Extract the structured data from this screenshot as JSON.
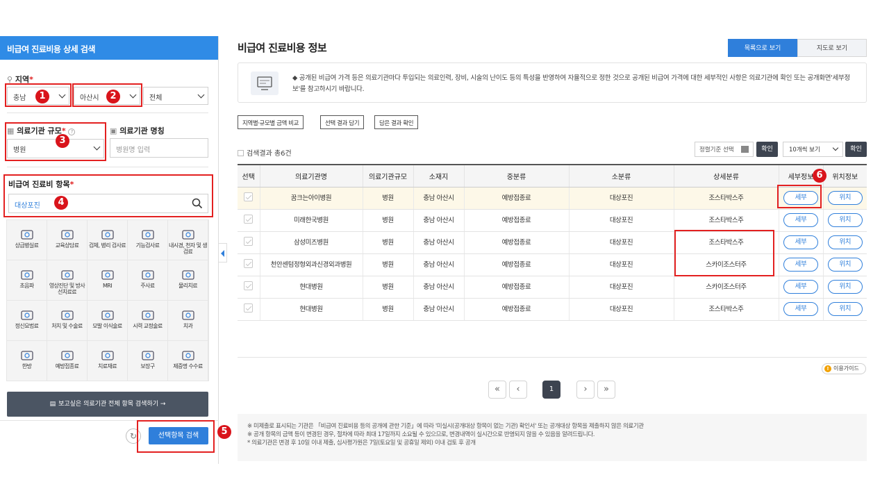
{
  "left": {
    "title": "비급여 진료비용 상세 검색",
    "region_label": "지역",
    "region": {
      "sido": "충남",
      "sigungu": "아산시",
      "dong": "전체"
    },
    "scale_label": "의료기관 규모",
    "scale_value": "병원",
    "name_label": "의료기관 명칭",
    "name_placeholder": "병원명 입력",
    "item_label": "비급여 진료비 항목",
    "item_value": "대상포진",
    "categories": [
      "상급병실료",
      "교육상담료",
      "검체, 병리 검사료",
      "기능검사료",
      "내시경, 천자 및 생검료",
      "초음파",
      "영상진단 및 방사선치료료",
      "MRI",
      "주사료",
      "물리치료",
      "정신요법료",
      "처치 및 수술료",
      "모발 이식술료",
      "시력 교정술료",
      "치과",
      "한방",
      "예방접종료",
      "치료재료",
      "보장구",
      "제증명 수수료"
    ],
    "all_button": "보고싶은 의료기관 전체 항목 검색하기 →",
    "search_button": "선택항목 검색",
    "reset_symbol": "↻"
  },
  "annotations": {
    "b1": "1",
    "b2": "2",
    "b3": "3",
    "b4": "4",
    "b5": "5",
    "b6": "6"
  },
  "main": {
    "title": "비급여 진료비용 정보",
    "view_list": "목록으로 보기",
    "view_map": "지도로 보기",
    "notice": "◆ 공개된 비급여 가격 등은 의료기관마다 투입되는 의료인력, 장비, 시술의 난이도 등의 특성을 반영하여 자율적으로 정한 것으로 공개된 비급여 가격에 대한 세부적인 사항은 의료기관에 확인 또는 공개화면'세부정보'를 참고하시기 바랍니다.",
    "btn_compare": "지역별·규모별 금액 비교",
    "btn_save": "선택 결과 담기",
    "btn_check": "담은 결과 확인",
    "count": "검색결과 총6건",
    "sort_placeholder": "정렬기준 선택",
    "sort_confirm": "확인",
    "per_page": "10개씩 보기",
    "per_confirm": "확인",
    "columns": [
      "선택",
      "의료기관명",
      "의료기관규모",
      "소재지",
      "중분류",
      "소분류",
      "상세분류",
      "세부정보",
      "위치정보"
    ],
    "rows": [
      {
        "name": "꿈크는아이병원",
        "scale": "병원",
        "loc": "충남 아산시",
        "mid": "예방접종료",
        "sub": "대상포진",
        "detail": "조스타박스주",
        "info": "세부",
        "pos": "위치"
      },
      {
        "name": "미래한국병원",
        "scale": "병원",
        "loc": "충남 아산시",
        "mid": "예방접종료",
        "sub": "대상포진",
        "detail": "조스타박스주",
        "info": "세부",
        "pos": "위치"
      },
      {
        "name": "삼성미즈병원",
        "scale": "병원",
        "loc": "충남 아산시",
        "mid": "예방접종료",
        "sub": "대상포진",
        "detail": "조스타박스주",
        "info": "세부",
        "pos": "위치"
      },
      {
        "name": "천안센텀정형외과신경외과병원",
        "scale": "병원",
        "loc": "충남 아산시",
        "mid": "예방접종료",
        "sub": "대상포진",
        "detail": "스카이조스터주",
        "info": "세부",
        "pos": "위치"
      },
      {
        "name": "현대병원",
        "scale": "병원",
        "loc": "충남 아산시",
        "mid": "예방접종료",
        "sub": "대상포진",
        "detail": "스카이조스터주",
        "info": "세부",
        "pos": "위치"
      },
      {
        "name": "현대병원",
        "scale": "병원",
        "loc": "충남 아산시",
        "mid": "예방접종료",
        "sub": "대상포진",
        "detail": "조스타박스주",
        "info": "세부",
        "pos": "위치"
      }
    ],
    "guide": "이용가이드",
    "pagination": {
      "first": "«",
      "prev": "‹",
      "current": "1",
      "next": "›",
      "last": "»"
    },
    "footnotes": [
      "※ 미제출로 표시되는 기관은 「비급여 진료비용 등의 공개에 관한 기준」에 따라 '미실시(공개대상 항목이 없는 기관) 확인서' 또는 공개대상 항목을 제출하지 않은 의료기관",
      "※ 공개 항목의 금액 등이 변경된 경우, 절차에 따라 최대 17일까지 소요될 수 있으므로, 변경내역이 실시간으로 반영되지 않을 수 있음을 알려드립니다.",
      "* 의료기관은 변경 후 10일 이내 제출, 심사평가원은 7일(토요일 및 공휴일 제외) 이내 검토 후 공개"
    ]
  },
  "colors": {
    "accent": "#2f8be6",
    "annotation_red": "#e32020",
    "button_blue": "#2f7fdb",
    "dark_button": "#3d4450"
  }
}
